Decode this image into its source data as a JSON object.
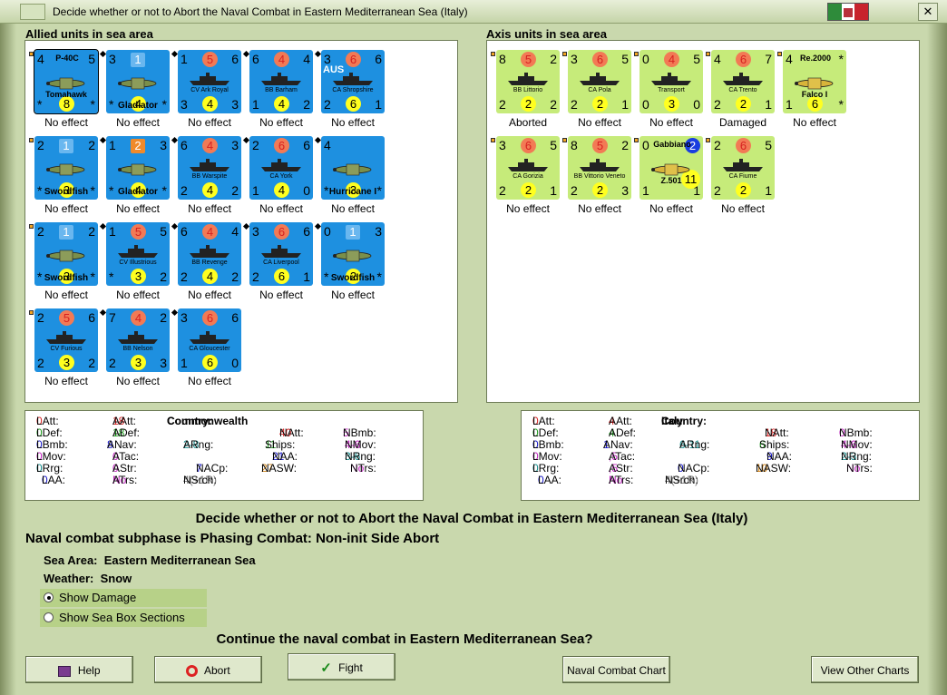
{
  "window": {
    "title": "Decide whether or not to Abort the Naval Combat in Eastern Mediterranean Sea (Italy)",
    "flag_colors": [
      "#2e8b3a",
      "#ffffff",
      "#c8232c"
    ]
  },
  "allied": {
    "title": "Allied units in sea area",
    "units": [
      {
        "name": "P-40C",
        "sub": "Tomahawk",
        "tl": "4",
        "tr": "5",
        "bl": "*",
        "br": "*",
        "yellow": "8",
        "effect": "No effect"
      },
      {
        "name": "Gladiator",
        "tl": "3",
        "tr": "",
        "sq": "1",
        "bl": "*",
        "br": "*",
        "yellow": "4",
        "effect": "No effect"
      },
      {
        "name": "CV Ark Royal",
        "tl": "1",
        "red": "5",
        "tr": "6",
        "bl": "3",
        "yellow": "4",
        "br": "3",
        "effect": "No effect"
      },
      {
        "name": "BB Barham",
        "tl": "6",
        "red": "4",
        "tr": "4",
        "bl": "1",
        "yellow": "4",
        "br": "2",
        "effect": "No effect"
      },
      {
        "name": "CA Shropshire",
        "tag": "AUS",
        "tl": "3",
        "red": "6",
        "tr": "6",
        "bl": "2",
        "yellow": "6",
        "br": "1",
        "effect": "No effect"
      },
      {
        "name": "Swordfish",
        "tl": "2",
        "sq": "1",
        "tr": "2",
        "bl": "*",
        "br": "*",
        "yellow": "3",
        "effect": "No effect"
      },
      {
        "name": "Gladiator",
        "tl": "1",
        "sq": "2",
        "tr": "3",
        "bl": "*",
        "br": "*",
        "yellow": "4",
        "effect": "No effect"
      },
      {
        "name": "BB Warspite",
        "tl": "6",
        "red": "4",
        "tr": "3",
        "bl": "2",
        "yellow": "4",
        "br": "2",
        "effect": "No effect"
      },
      {
        "name": "CA York",
        "tl": "2",
        "red": "6",
        "tr": "6",
        "bl": "1",
        "yellow": "4",
        "br": "0",
        "effect": "No effect"
      },
      {
        "name": "Hurricane I",
        "tl": "4",
        "tr": "",
        "bl": "*",
        "br": "*",
        "yellow": "3",
        "effect": "No effect"
      },
      {
        "name": "Swordfish",
        "tl": "2",
        "sq": "1",
        "tr": "2",
        "bl": "*",
        "br": "*",
        "yellow": "3",
        "effect": "No effect"
      },
      {
        "name": "CV Illustrious",
        "tl": "1",
        "red": "5",
        "tr": "5",
        "bl": "*",
        "yellow": "3",
        "br": "2",
        "effect": "No effect"
      },
      {
        "name": "BB Revenge",
        "tl": "6",
        "red": "4",
        "tr": "4",
        "bl": "2",
        "yellow": "4",
        "br": "2",
        "effect": "No effect"
      },
      {
        "name": "CA Liverpool",
        "tl": "3",
        "red": "6",
        "tr": "6",
        "bl": "2",
        "yellow": "6",
        "br": "1",
        "effect": "No effect"
      },
      {
        "name": "Swordfish",
        "tl": "0",
        "sq": "1",
        "tr": "3",
        "bl": "*",
        "br": "*",
        "yellow": "2",
        "effect": "No effect"
      },
      {
        "name": "CV Furious",
        "tl": "2",
        "red": "5",
        "tr": "6",
        "bl": "2",
        "yellow": "3",
        "br": "2",
        "effect": "No effect"
      },
      {
        "name": "BB Nelson",
        "tl": "7",
        "red": "4",
        "tr": "2",
        "bl": "2",
        "yellow": "3",
        "br": "3",
        "effect": "No effect"
      },
      {
        "name": "CA Gloucester",
        "tl": "3",
        "red": "6",
        "tr": "6",
        "bl": "1",
        "yellow": "6",
        "br": "0",
        "effect": "No effect"
      }
    ]
  },
  "axis": {
    "title": "Axis units in sea area",
    "units": [
      {
        "name": "BB Littorio",
        "tl": "8",
        "red": "5",
        "tr": "2",
        "bl": "2",
        "yellow": "2",
        "br": "2",
        "effect": "Aborted"
      },
      {
        "name": "CA Pola",
        "tl": "3",
        "red": "6",
        "tr": "5",
        "bl": "2",
        "yellow": "2",
        "br": "1",
        "effect": "No effect"
      },
      {
        "name": "Transport",
        "tl": "0",
        "red": "4",
        "tr": "5",
        "bl": "0",
        "yellow": "3",
        "br": "0",
        "effect": "No effect"
      },
      {
        "name": "CA Trento",
        "tl": "4",
        "red": "6",
        "tr": "7",
        "bl": "2",
        "yellow": "2",
        "br": "1",
        "effect": "Damaged"
      },
      {
        "name": "Re.2000",
        "sub": "Falco I",
        "tl": "4",
        "tr": "*",
        "bl": "1",
        "yellow": "6",
        "br": "*",
        "effect": "No effect"
      },
      {
        "name": "CA Gorizia",
        "tl": "3",
        "red": "6",
        "tr": "5",
        "bl": "2",
        "yellow": "2",
        "br": "1",
        "effect": "No effect"
      },
      {
        "name": "BB Vittorio Veneto",
        "tl": "8",
        "red": "5",
        "tr": "2",
        "bl": "2",
        "yellow": "2",
        "br": "3",
        "effect": "No effect"
      },
      {
        "name": "Gabbiano",
        "sub": "Z.501",
        "tl": "0",
        "blue": "2",
        "bl": "1",
        "yellow": "11",
        "br": "1",
        "effect": "No effect"
      },
      {
        "name": "CA Fiume",
        "tl": "2",
        "red": "6",
        "tr": "5",
        "bl": "2",
        "yellow": "2",
        "br": "1",
        "effect": "No effect"
      }
    ]
  },
  "allied_stats": {
    "country_label": "Country:",
    "country": "Commonwealth",
    "latt": "0",
    "aatt": "18",
    "natt": "40",
    "nbmb": "5",
    "ldef": "0",
    "adef": "18",
    "ships": "11",
    "nmov": "4-6",
    "lbmb": "0",
    "anav": "8",
    "arng": "2-8",
    "naa": "21",
    "nrng": "3-6",
    "lmov": "0",
    "atac": "0",
    "lrng": "0",
    "astr": "0",
    "nacp": "7",
    "nasw": "27",
    "ntrs": "No",
    "laa": "0",
    "atrs": "No",
    "nsrch": "4(+1R)"
  },
  "axis_stats": {
    "country_label": "Country:",
    "country": "Italy",
    "latt": "0",
    "aatt": "4",
    "natt": "18",
    "nbmb": "0",
    "ldef": "0",
    "adef": "4",
    "ships": "6",
    "nmov": "4-6",
    "lbmb": "0",
    "anav": "1",
    "arng": "6-11",
    "naa": "9",
    "nrng": "2-3",
    "lmov": "0",
    "atac": ",5",
    "lrng": "0",
    "astr": ",5",
    "nacp": "0",
    "nasw": "10",
    "ntrs": "No",
    "laa": "0",
    "atrs": "No",
    "nsrch": "4(+1R)"
  },
  "labels": {
    "latt": "LAtt:",
    "ldef": "LDef:",
    "lbmb": "LBmb:",
    "lmov": "LMov:",
    "lrng": "LRrg:",
    "laa": "LAA:",
    "aatt": "AAtt:",
    "adef": "ADef:",
    "anav": "ANav:",
    "atac": "ATac:",
    "astr": "AStr:",
    "atrs": "ATrs:",
    "arng": "ARng:",
    "nacp": "NACp:",
    "nsrch": "NSrch:",
    "natt": "NAtt:",
    "ships": "Ships:",
    "naa": "NAA:",
    "nasw": "NASW:",
    "nbmb": "NBmb:",
    "nmov": "NMov:",
    "nrng": "NRng:",
    "ntrs": "NTrs:"
  },
  "info": {
    "heading": "Decide whether or not to Abort the Naval Combat in Eastern Mediterranean Sea (Italy)",
    "subphase": "Naval combat subphase is Phasing Combat: Non-init Side Abort",
    "sea_area_label": "Sea Area:",
    "sea_area": "Eastern Mediterranean Sea",
    "weather_label": "Weather:",
    "weather": "Snow",
    "show_damage": "Show Damage",
    "show_sea_box": "Show Sea Box Sections",
    "question": "Continue the naval combat in Eastern Mediterranean Sea?"
  },
  "buttons": {
    "help": "Help",
    "abort": "Abort",
    "fight": "Fight",
    "naval_chart": "Naval Combat Chart",
    "other_charts": "View Other Charts"
  }
}
